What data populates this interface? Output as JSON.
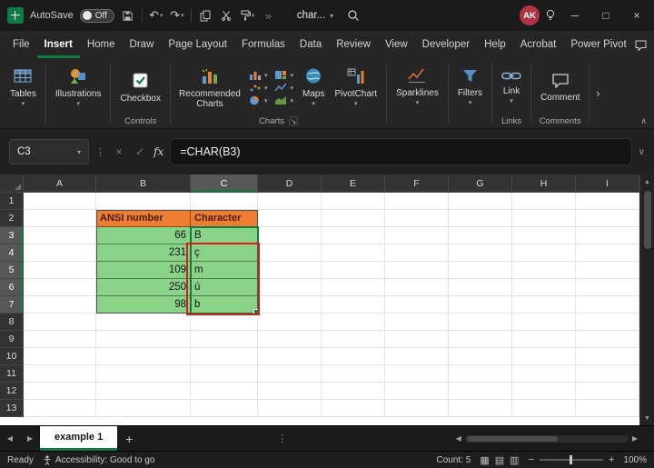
{
  "titlebar": {
    "autosave_label": "AutoSave",
    "autosave_state": "Off",
    "doc_title": "char...",
    "avatar_initials": "AK",
    "icons": [
      "excel-logo",
      "save",
      "undo",
      "redo",
      "copy",
      "cut",
      "format-painter",
      "more-commands",
      "search",
      "lightbulb",
      "minimize",
      "maximize",
      "close"
    ]
  },
  "menu": {
    "items": [
      "File",
      "Insert",
      "Home",
      "Draw",
      "Page Layout",
      "Formulas",
      "Data",
      "Review",
      "View",
      "Developer",
      "Help",
      "Acrobat",
      "Power Pivot"
    ],
    "active_item": "Insert"
  },
  "ribbon": {
    "buttons": [
      {
        "label": "Tables"
      },
      {
        "label": "Illustrations"
      },
      {
        "label": "Checkbox"
      },
      {
        "label": "Recommended Charts"
      },
      {
        "label": "Maps"
      },
      {
        "label": "PivotChart"
      },
      {
        "label": "Sparklines"
      },
      {
        "label": "Filters"
      },
      {
        "label": "Link"
      },
      {
        "label": "Comment"
      }
    ],
    "group_labels": {
      "controls": "Controls",
      "charts": "Charts",
      "links": "Links",
      "comments": "Comments"
    },
    "chart_type_icons": [
      "column-chart",
      "treemap-chart",
      "scatter-chart",
      "line-chart",
      "pie-chart",
      "area-chart"
    ]
  },
  "formula_bar": {
    "name_box": "C3",
    "fx_label": "fx",
    "formula": "=CHAR(B3)"
  },
  "grid": {
    "columns": [
      "A",
      "B",
      "C",
      "D",
      "E",
      "F",
      "G",
      "H",
      "I"
    ],
    "rows": [
      "1",
      "2",
      "3",
      "4",
      "5",
      "6",
      "7",
      "8",
      "9",
      "10",
      "11",
      "12",
      "13"
    ],
    "active_columns": [
      "C"
    ],
    "active_rows": [
      "3",
      "4",
      "5",
      "6",
      "7"
    ],
    "cells": [
      {
        "ref": "B2",
        "value": "ANSI number",
        "fill": "header",
        "align": "left"
      },
      {
        "ref": "C2",
        "value": "Character",
        "fill": "header",
        "align": "left"
      },
      {
        "ref": "B3",
        "value": "66",
        "fill": "data",
        "align": "right"
      },
      {
        "ref": "C3",
        "value": "B",
        "fill": "data",
        "align": "left"
      },
      {
        "ref": "B4",
        "value": "231",
        "fill": "data",
        "align": "right"
      },
      {
        "ref": "C4",
        "value": "ç",
        "fill": "data",
        "align": "left"
      },
      {
        "ref": "B5",
        "value": "109",
        "fill": "data",
        "align": "right"
      },
      {
        "ref": "C5",
        "value": "m",
        "fill": "data",
        "align": "left"
      },
      {
        "ref": "B6",
        "value": "250",
        "fill": "data",
        "align": "right"
      },
      {
        "ref": "C6",
        "value": "ú",
        "fill": "data",
        "align": "left"
      },
      {
        "ref": "B7",
        "value": "98",
        "fill": "data",
        "align": "right"
      },
      {
        "ref": "C7",
        "value": "b",
        "fill": "data",
        "align": "left"
      }
    ],
    "selection": {
      "range": "C3:C7",
      "active_cell": "C3"
    }
  },
  "sheet_tabs": {
    "tabs": [
      "example 1"
    ],
    "active_tab": "example 1"
  },
  "status_bar": {
    "mode": "Ready",
    "accessibility": "Accessibility: Good to go",
    "count": "Count: 5",
    "zoom": "100%",
    "view_icons": [
      "normal-view",
      "page-layout-view",
      "page-break-preview"
    ]
  },
  "colors": {
    "accent_green": "#107C41",
    "table_header_fill": "#ED7D31",
    "table_header_text": "#471C00",
    "table_cell_fill": "#89D389",
    "annotation_red": "#E11818",
    "avatar_bg": "#B03446",
    "share_green": "#0F7B3E"
  }
}
